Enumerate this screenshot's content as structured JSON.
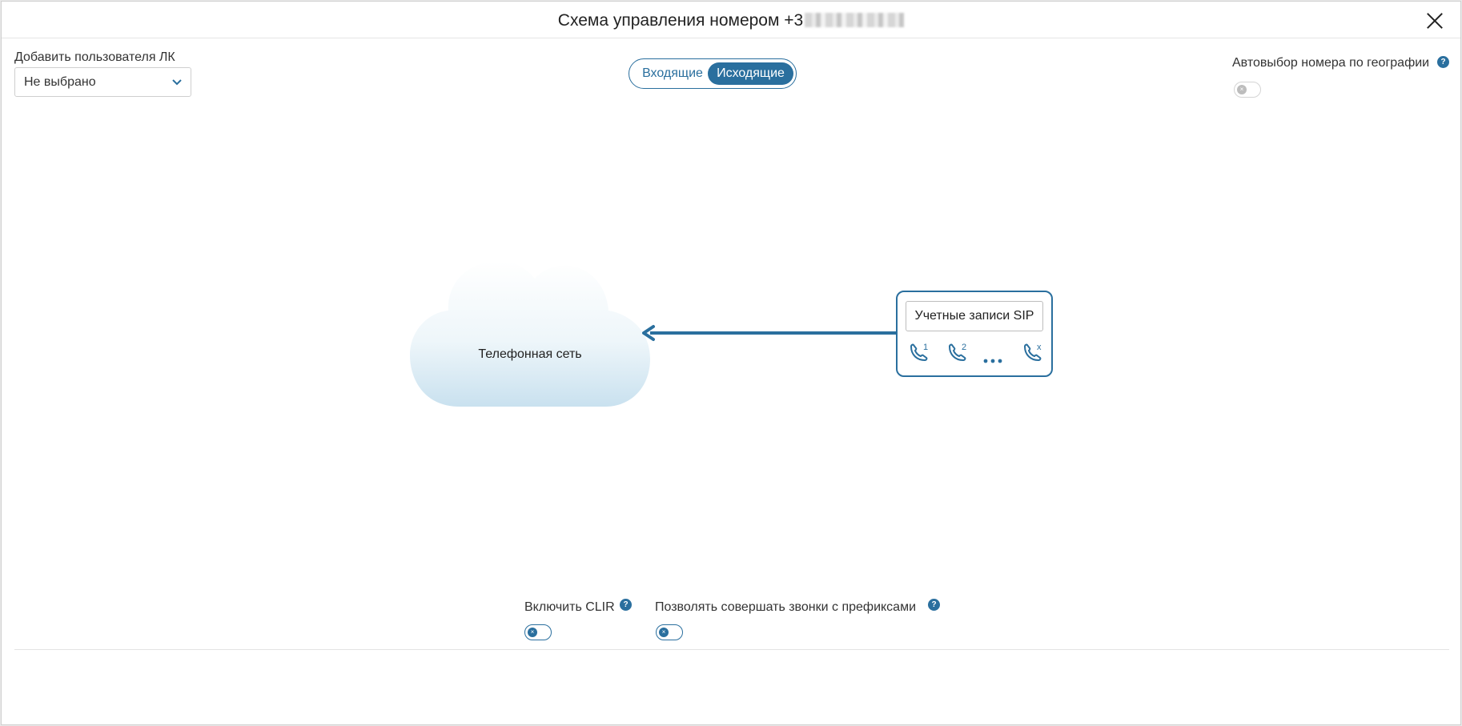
{
  "dialog": {
    "title": "Схема управления номером +3",
    "title_masked_part": "[redacted]"
  },
  "lk_user": {
    "label": "Добавить пользователя ЛК",
    "selected": "Не выбрано"
  },
  "direction_tabs": {
    "incoming": "Входящие",
    "outgoing": "Исходящие",
    "active": "outgoing"
  },
  "geo_autoselect": {
    "label": "Автовыбор номера по географии",
    "help": "?",
    "enabled": false
  },
  "diagram": {
    "cloud_label": "Телефонная сеть",
    "sip_label": "Учетные записи SIP",
    "phones": [
      "1",
      "2",
      "x"
    ]
  },
  "options": {
    "clir_label": "Включить CLIR",
    "clir_enabled": false,
    "prefix_label": "Позволять совершать звонки с префиксами",
    "prefix_enabled": false,
    "help": "?",
    "switch_off_glyph": "×"
  },
  "colors": {
    "accent": "#2a6f9e",
    "cloud_light": "#ffffff",
    "cloud_shadow": "#c9e1ef"
  }
}
